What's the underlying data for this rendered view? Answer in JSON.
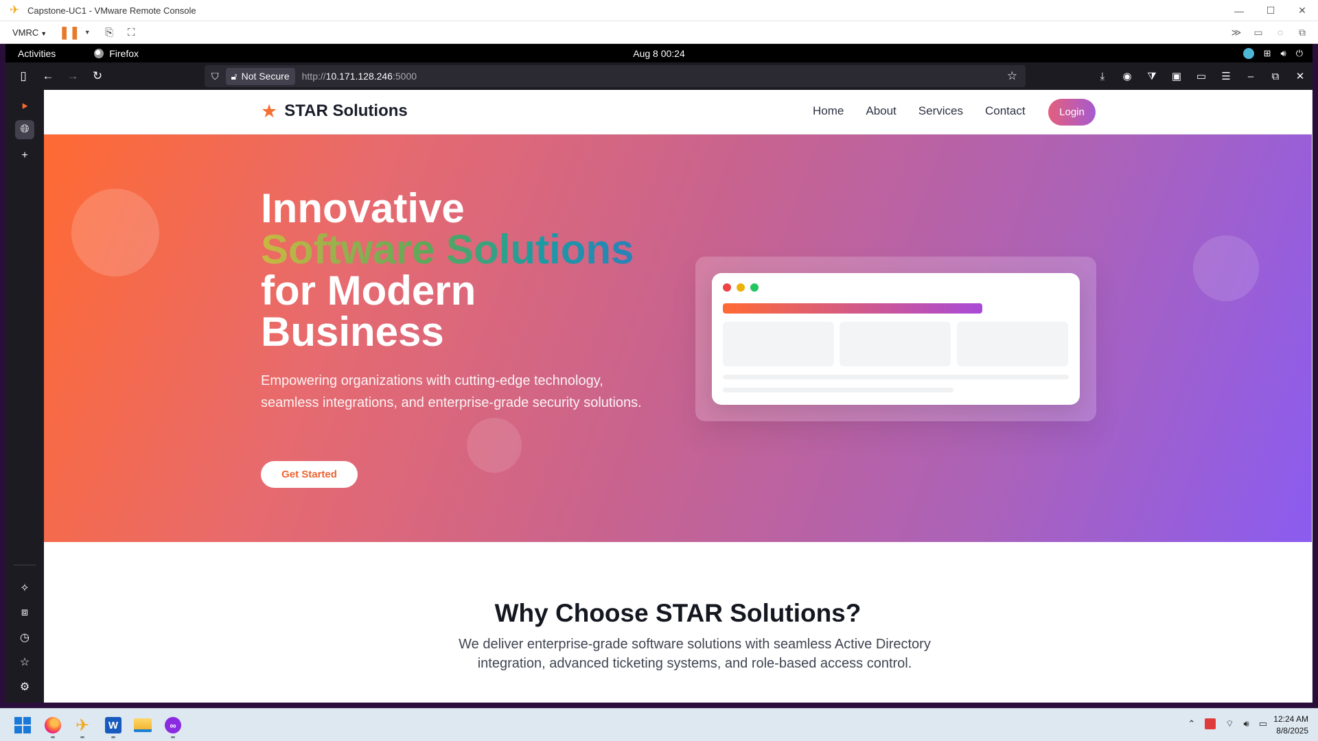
{
  "vmrc": {
    "window_title": "Capstone-UC1 - VMware Remote Console",
    "menu_label": "VMRC",
    "minimize": "—",
    "maximize": "☐",
    "close": "✕"
  },
  "gnome": {
    "activities": "Activities",
    "app_name": "Firefox",
    "clock": "Aug 8  00:24"
  },
  "browser": {
    "not_secure": "Not Secure",
    "url_scheme": "http://",
    "url_host": "10.171.128.246",
    "url_port": ":5000"
  },
  "site": {
    "brand": "STAR Solutions",
    "nav": [
      "Home",
      "About",
      "Services",
      "Contact"
    ],
    "login": "Login",
    "hero": {
      "line1": "Innovative",
      "line2": "Software Solutions",
      "line3": "for Modern",
      "line4": "Business",
      "subtitle": "Empowering organizations with cutting-edge technology, seamless integrations, and enterprise-grade security solutions.",
      "cta": "Get Started"
    },
    "why": {
      "title": "Why Choose STAR Solutions?",
      "description": "We deliver enterprise-grade software solutions with seamless Active Directory integration, advanced ticketing systems, and role-based access control."
    }
  },
  "taskbar": {
    "time": "12:24 AM",
    "date": "8/8/2025"
  },
  "colors": {
    "brand_orange": "#f46e2f",
    "hero_start": "#ff6a33",
    "hero_end": "#8b5cf0",
    "dot_red": "#ef4444",
    "dot_yellow": "#eab308",
    "dot_green": "#22c55e"
  }
}
